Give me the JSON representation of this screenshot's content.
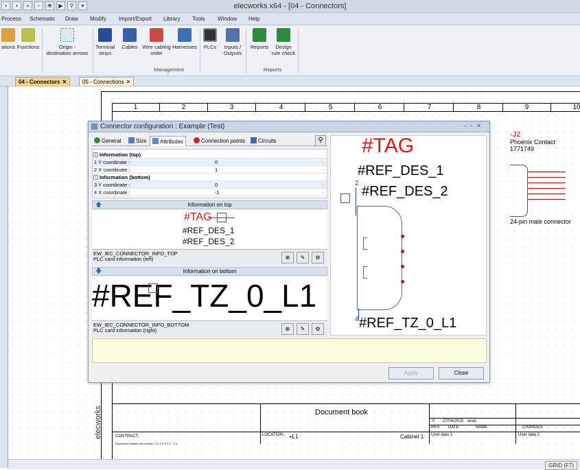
{
  "window": {
    "title": "elecworks x64 - [04 - Connectors]"
  },
  "menu": [
    "Process",
    "Schematic",
    "Draw",
    "Modify",
    "Import/Export",
    "Library",
    "Tools",
    "Window",
    "Help"
  ],
  "ribbon": {
    "buttons": [
      {
        "l1": "ations",
        "l2": ""
      },
      {
        "l1": "Functions",
        "l2": ""
      },
      {
        "l1": "Origin -",
        "l2": "destination arrows"
      },
      {
        "l1": "Terminal",
        "l2": "strips"
      },
      {
        "l1": "Cables",
        "l2": ""
      },
      {
        "l1": "Wire cabling",
        "l2": "order"
      },
      {
        "l1": "Harnesses",
        "l2": ""
      },
      {
        "l1": "PLCs",
        "l2": ""
      },
      {
        "l1": "Inputs /",
        "l2": "Outputs"
      },
      {
        "l1": "Reports",
        "l2": ""
      },
      {
        "l1": "Design",
        "l2": "rule check"
      }
    ],
    "groups": [
      "Management",
      "Reports"
    ]
  },
  "tabs": [
    {
      "label": "04 - Connectors",
      "active": true
    },
    {
      "label": "05 - Connections",
      "active": false
    }
  ],
  "ruler": [
    "1",
    "2",
    "3",
    "4",
    "5",
    "6",
    "7",
    "8",
    "9",
    "10"
  ],
  "j2": {
    "tag": "-J2",
    "maker": "Phoenix Contact",
    "ref": "1771749",
    "desc": "24-pin male connector"
  },
  "titleblock": {
    "doc": "Document book",
    "brand": "elecworks",
    "contract": "CONTRACT:",
    "location_label": "LOCATION:",
    "location": "+L1",
    "cabinet": "Cabinet 1",
    "rev": "0",
    "date": "27/04/2015",
    "author": "aruiz",
    "col_rev": "REV.",
    "col_date": "DATE",
    "col_name": "NAME",
    "col_changes": "CHANGES",
    "user1": "User data 1",
    "user2": "User data 2",
    "version": "Document realised with version: 2 0 1 5 S P 0 . 2 4"
  },
  "dialog": {
    "title": "Connector configuration : Example (Test)",
    "tabs": [
      "General",
      "Size",
      "Attributes",
      "Connection points",
      "Circuits"
    ],
    "properties": [
      {
        "type": "header",
        "label": "Information (top)"
      },
      {
        "type": "row",
        "label": "1  Y coordinate :",
        "value": "0"
      },
      {
        "type": "row",
        "label": "2  X coordinate :",
        "value": "1"
      },
      {
        "type": "header",
        "label": "Information (bottom)"
      },
      {
        "type": "row",
        "label": "3  Y coordinate :",
        "value": "0"
      },
      {
        "type": "row",
        "label": "4  X coordinate :",
        "value": "-1"
      }
    ],
    "top_section": "Information on top",
    "bottom_section": "Information on bottom",
    "preview_tag": "#TAG",
    "preview_ref1": "#REF_DES_1",
    "preview_ref2": "#REF_DES_2",
    "preview_bottom": "#REF_TZ_0_L1",
    "top_info_name": "EW_IEC_CONNECTOR_INFO_TOP",
    "top_info_desc": "PLC card information (left)",
    "bottom_info_name": "EW_IEC_CONNECTOR_INFO_BOTTOM",
    "bottom_info_desc": "PLC card information (right)",
    "draw_tag": "#TAG",
    "draw_ref1": "#REF_DES_1",
    "draw_ref2": "#REF_DES_2",
    "draw_bottom": "#REF_TZ_0_L1",
    "marker_top": "2",
    "marker_bottom": "4",
    "apply": "Apply",
    "close": "Close"
  },
  "status": {
    "grid": "GRID (F7)"
  },
  "colors": {
    "accent_red": "#ee1111",
    "tab_active": "#f6d680"
  }
}
